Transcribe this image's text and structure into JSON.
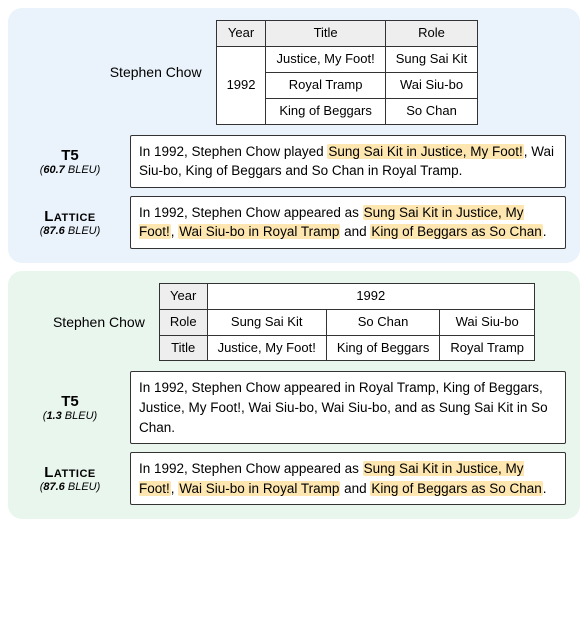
{
  "top": {
    "caption": "Stephen Chow",
    "table": {
      "headers": [
        "Year",
        "Title",
        "Role"
      ],
      "year": "1992",
      "rows": [
        {
          "title": "Justice, My Foot!",
          "role": "Sung Sai Kit"
        },
        {
          "title": "Royal Tramp",
          "role": "Wai Siu-bo"
        },
        {
          "title": "King of Beggars",
          "role": "So Chan"
        }
      ]
    },
    "t5": {
      "name": "T5",
      "bleu_val": "60.7",
      "bleu_unit": "BLEU",
      "pre": "In 1992, Stephen Chow played ",
      "hl1": "Sung Sai Kit in Justice, My Foot!",
      "post": ", Wai Siu-bo, King of Beggars and So Chan in Royal Tramp."
    },
    "lattice": {
      "name": "Lattice",
      "bleu_val": "87.6",
      "bleu_unit": "BLEU",
      "pre": "In 1992, Stephen Chow appeared as ",
      "hl1": "Sung Sai Kit in Justice, My Foot!",
      "mid1": ", ",
      "hl2": "Wai Siu-bo in Royal Tramp",
      "mid2": " and ",
      "hl3": "King of Beggars as So Chan",
      "post": "."
    }
  },
  "bottom": {
    "caption": "Stephen Chow",
    "table": {
      "year_label": "Year",
      "year_value": "1992",
      "role_label": "Role",
      "roles": [
        "Sung Sai Kit",
        "So Chan",
        "Wai Siu-bo"
      ],
      "title_label": "Title",
      "titles": [
        "Justice, My Foot!",
        "King of Beggars",
        "Royal Tramp"
      ]
    },
    "t5": {
      "name": "T5",
      "bleu_val": "1.3",
      "bleu_unit": "BLEU",
      "text": "In 1992, Stephen Chow appeared in Royal Tramp, King of Beggars, Justice, My Foot!, Wai Siu-bo, Wai Siu-bo, and as Sung Sai Kit in So Chan."
    },
    "lattice": {
      "name": "Lattice",
      "bleu_val": "87.6",
      "bleu_unit": "BLEU",
      "pre": "In 1992, Stephen Chow appeared as ",
      "hl1": "Sung Sai Kit in Justice, My Foot!",
      "mid1": ", ",
      "hl2": "Wai Siu-bo in Royal Tramp",
      "mid2": " and ",
      "hl3": "King of Beggars as So Chan",
      "post": "."
    }
  }
}
